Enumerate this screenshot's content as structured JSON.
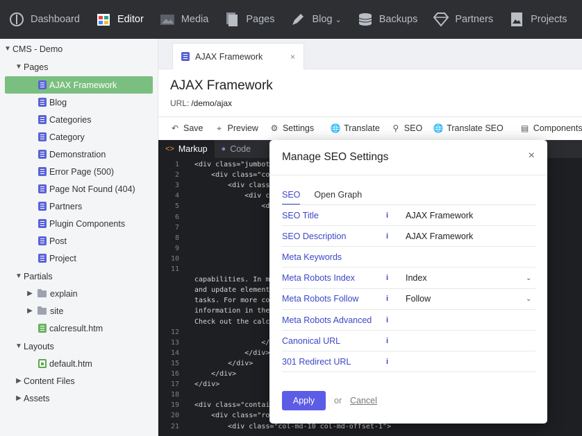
{
  "nav": {
    "items": [
      {
        "label": "Dashboard",
        "icon": "dashboard-icon"
      },
      {
        "label": "Editor",
        "icon": "editor-icon"
      },
      {
        "label": "Media",
        "icon": "media-icon"
      },
      {
        "label": "Pages",
        "icon": "pages-icon"
      },
      {
        "label": "Blog",
        "icon": "blog-icon"
      },
      {
        "label": "Backups",
        "icon": "backups-icon"
      },
      {
        "label": "Partners",
        "icon": "partners-icon"
      },
      {
        "label": "Projects",
        "icon": "projects-icon"
      }
    ]
  },
  "sidebar": {
    "root": "CMS - Demo",
    "pages_label": "Pages",
    "pages": [
      "AJAX Framework",
      "Blog",
      "Categories",
      "Category",
      "Demonstration",
      "Error Page (500)",
      "Page Not Found (404)",
      "Partners",
      "Plugin Components",
      "Post",
      "Project"
    ],
    "partials_label": "Partials",
    "partials": [
      "explain",
      "site",
      "calcresult.htm"
    ],
    "layouts_label": "Layouts",
    "layouts": [
      "default.htm"
    ],
    "content_files_label": "Content Files",
    "assets_label": "Assets"
  },
  "tab": {
    "label": "AJAX Framework",
    "close": "×"
  },
  "page": {
    "title": "AJAX Framework",
    "url_label": "URL:",
    "url": "/demo/ajax"
  },
  "toolbar": {
    "save": "Save",
    "preview": "Preview",
    "settings": "Settings",
    "translate": "Translate",
    "seo": "SEO",
    "translate_seo": "Translate SEO",
    "components": "Components"
  },
  "editor": {
    "tabs": [
      "Markup",
      "Code"
    ],
    "lines": [
      {
        "n": "1",
        "t": "<div class=\"jumbot"
      },
      {
        "n": "2",
        "t": "    <div class=\"co"
      },
      {
        "n": "3",
        "t": "        <div class"
      },
      {
        "n": "4",
        "t": "            <div c"
      },
      {
        "n": "5",
        "t": "                <d"
      },
      {
        "n": "6",
        "t": ""
      },
      {
        "n": "7",
        "t": ""
      },
      {
        "n": "8",
        "t": ""
      },
      {
        "n": "9",
        "t": ""
      },
      {
        "n": "10",
        "t": ""
      },
      {
        "n": "11",
        "t": ""
      },
      {
        "n": "",
        "t": "capabilities. In m"
      },
      {
        "n": "",
        "t": "and update element"
      },
      {
        "n": "",
        "t": "tasks. For more co"
      },
      {
        "n": "",
        "t": "information in the"
      },
      {
        "n": "",
        "t": "Check out the calc"
      },
      {
        "n": "12",
        "t": ""
      },
      {
        "n": "13",
        "t": "                </"
      },
      {
        "n": "14",
        "t": "            </div>"
      },
      {
        "n": "15",
        "t": "        </div>"
      },
      {
        "n": "16",
        "t": "    </div>"
      },
      {
        "n": "17",
        "t": "</div>"
      },
      {
        "n": "18",
        "t": ""
      },
      {
        "n": "19",
        "t": "<div class=\"contai"
      },
      {
        "n": "20",
        "t": "    <div class=\"ro"
      },
      {
        "n": "21",
        "t": "        <div class=\"col-md-10 col-md-offset-1\">"
      }
    ]
  },
  "modal": {
    "title": "Manage SEO Settings",
    "close": "×",
    "tabs": [
      "SEO",
      "Open Graph"
    ],
    "info_glyph": "i",
    "fields": [
      {
        "label": "SEO Title",
        "info": true,
        "value": "AJAX Framework",
        "dropdown": false
      },
      {
        "label": "SEO Description",
        "info": true,
        "value": "AJAX Framework",
        "dropdown": false
      },
      {
        "label": "Meta Keywords",
        "info": false,
        "value": "",
        "dropdown": false
      },
      {
        "label": "Meta Robots Index",
        "info": true,
        "value": "Index",
        "dropdown": true
      },
      {
        "label": "Meta Robots Follow",
        "info": true,
        "value": "Follow",
        "dropdown": true
      },
      {
        "label": "Meta Robots Advanced",
        "info": true,
        "value": "",
        "dropdown": false
      },
      {
        "label": "Canonical URL",
        "info": true,
        "value": "",
        "dropdown": false
      },
      {
        "label": "301 Redirect URL",
        "info": true,
        "value": "",
        "dropdown": false
      }
    ],
    "apply": "Apply",
    "or": "or",
    "cancel": "Cancel"
  },
  "colors": {
    "nav_bg": "#2d2f33",
    "selected_tree": "#7bbf80",
    "accent": "#5d5ce6",
    "link_blue": "#3b47c8"
  }
}
